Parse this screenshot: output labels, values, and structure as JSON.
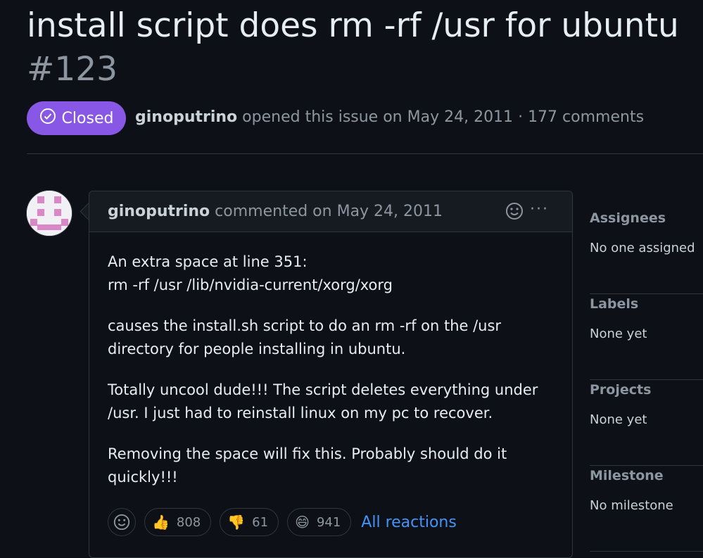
{
  "issue": {
    "title": "install script does rm -rf /usr for ubuntu",
    "number": "#123",
    "status": "Closed",
    "author": "ginoputrino",
    "opened_text": "opened this issue on May 24, 2011",
    "separator": "·",
    "comments": "177 comments"
  },
  "comment": {
    "author": "ginoputrino",
    "action": "commented on May 24, 2011",
    "paragraphs": [
      [
        "An extra space at line 351:",
        "rm -rf /usr /lib/nvidia-current/xorg/xorg"
      ],
      [
        "causes the install.sh script to do an rm -rf on the /usr",
        "directory for people installing in ubuntu."
      ],
      [
        "Totally uncool dude!!! The script deletes everything under",
        "/usr. I just had to reinstall linux on my pc to recover."
      ],
      [
        "Removing the space will fix this. Probably should do it",
        "quickly!!!"
      ]
    ],
    "more_icon": "···"
  },
  "reactions": {
    "thumbs_up": {
      "emoji": "👍",
      "count": "808"
    },
    "thumbs_down": {
      "emoji": "👎",
      "count": "61"
    },
    "laugh": {
      "emoji": "😄",
      "count": "941"
    },
    "all_label": "All reactions"
  },
  "sidebar": {
    "assignees": {
      "heading": "Assignees",
      "value": "No one assigned"
    },
    "labels": {
      "heading": "Labels",
      "value": "None yet"
    },
    "projects": {
      "heading": "Projects",
      "value": "None yet"
    },
    "milestone": {
      "heading": "Milestone",
      "value": "No milestone"
    }
  },
  "colors": {
    "closed_badge": "#8957e5",
    "link": "#4493f8",
    "background": "#0d1117"
  }
}
